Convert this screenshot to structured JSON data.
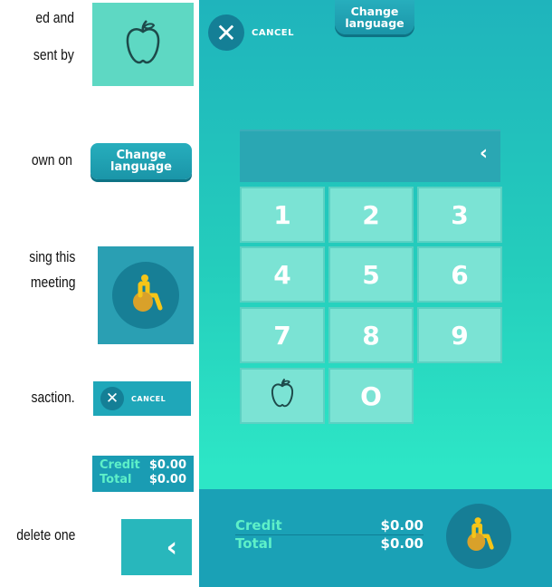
{
  "doc": {
    "lines": [
      "ed and",
      "sent  by",
      "own  on",
      "sing this",
      "meeting",
      "saction.",
      "delete one"
    ]
  },
  "apple_card": {
    "icon": "apple-icon"
  },
  "lang_card": {
    "line1": "Change",
    "line2": "language"
  },
  "access_card": {
    "icon": "wheelchair-icon"
  },
  "cancel_card": {
    "label": "CANCEL",
    "icon": "close-icon"
  },
  "totals_card": {
    "credit_label": "Credit",
    "credit_value": "$0.00",
    "total_label": "Total",
    "total_value": "$0.00"
  },
  "back_card": {
    "icon": "chevron-left-icon",
    "glyph": "‹"
  },
  "kiosk": {
    "cancel_label": "CANCEL",
    "lang_line1": "Change",
    "lang_line2": "language",
    "display_value": "",
    "backspace_glyph": "‹",
    "keys": [
      "1",
      "2",
      "3",
      "4",
      "5",
      "6",
      "7",
      "8",
      "9",
      "",
      "O"
    ],
    "credit_label": "Credit",
    "credit_value": "$0.00",
    "total_label": "Total",
    "total_value": "$0.00"
  },
  "colors": {
    "accent": "#1fb4bc",
    "dark": "#167e96",
    "label_green": "#5ef0c8"
  }
}
